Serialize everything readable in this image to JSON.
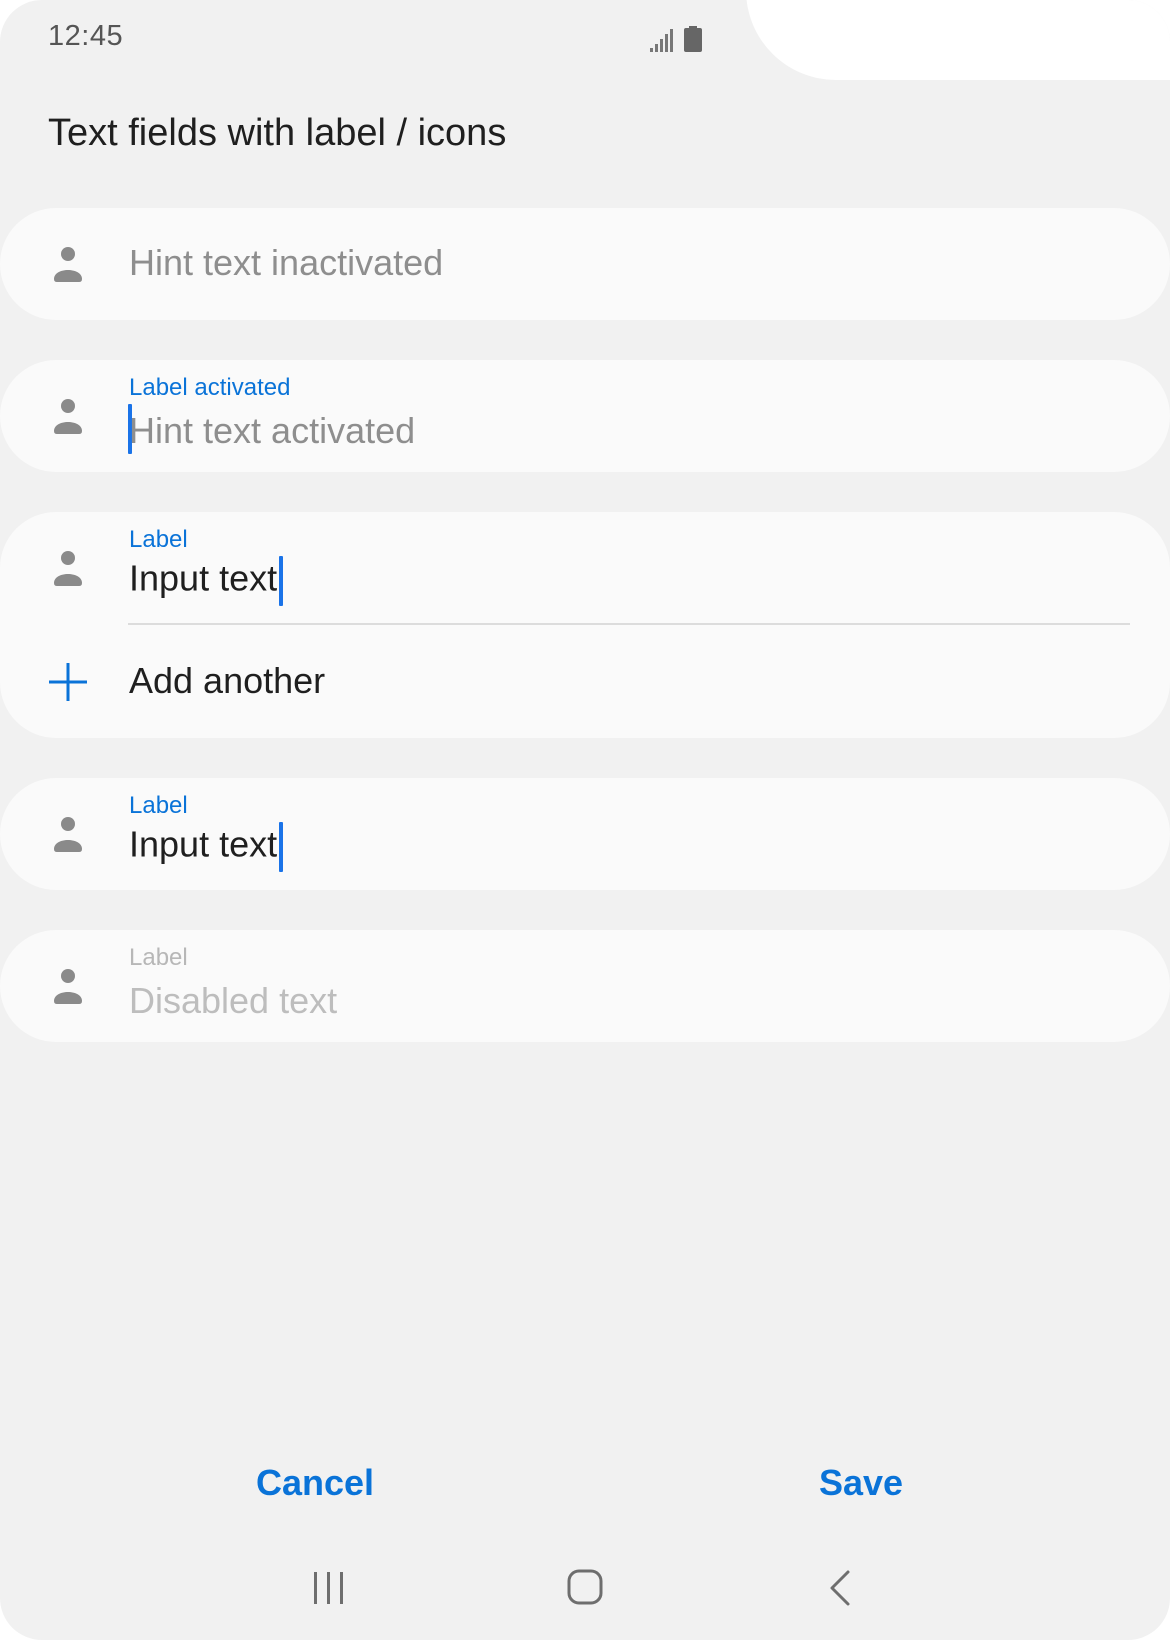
{
  "status_bar": {
    "time": "12:45",
    "icons": [
      "signal-icon",
      "battery-icon"
    ]
  },
  "page": {
    "title": "Text fields with label / icons"
  },
  "fields": [
    {
      "state": "inactive",
      "icon": "person-icon",
      "hint": "Hint text inactivated"
    },
    {
      "state": "activated",
      "icon": "person-icon",
      "label": "Label activated",
      "hint": "Hint text activated"
    },
    {
      "state": "focused",
      "icon": "person-icon",
      "label": "Label",
      "value": "Input text",
      "add_label": "Add another",
      "add_icon": "plus-icon"
    },
    {
      "state": "focused",
      "icon": "person-icon",
      "label": "Label",
      "value": "Input text"
    },
    {
      "state": "disabled",
      "icon": "person-icon",
      "label": "Label",
      "value": "Disabled text"
    }
  ],
  "actions": {
    "cancel_label": "Cancel",
    "save_label": "Save"
  },
  "nav_bar": {
    "icons": [
      "recent-apps-icon",
      "home-icon",
      "back-icon"
    ]
  },
  "colors": {
    "accent": "#0a73d8",
    "cursor": "#1a73e8",
    "background": "#f1f1f1",
    "field_background": "#fafafa",
    "icon_gray": "#8a8a8a"
  }
}
